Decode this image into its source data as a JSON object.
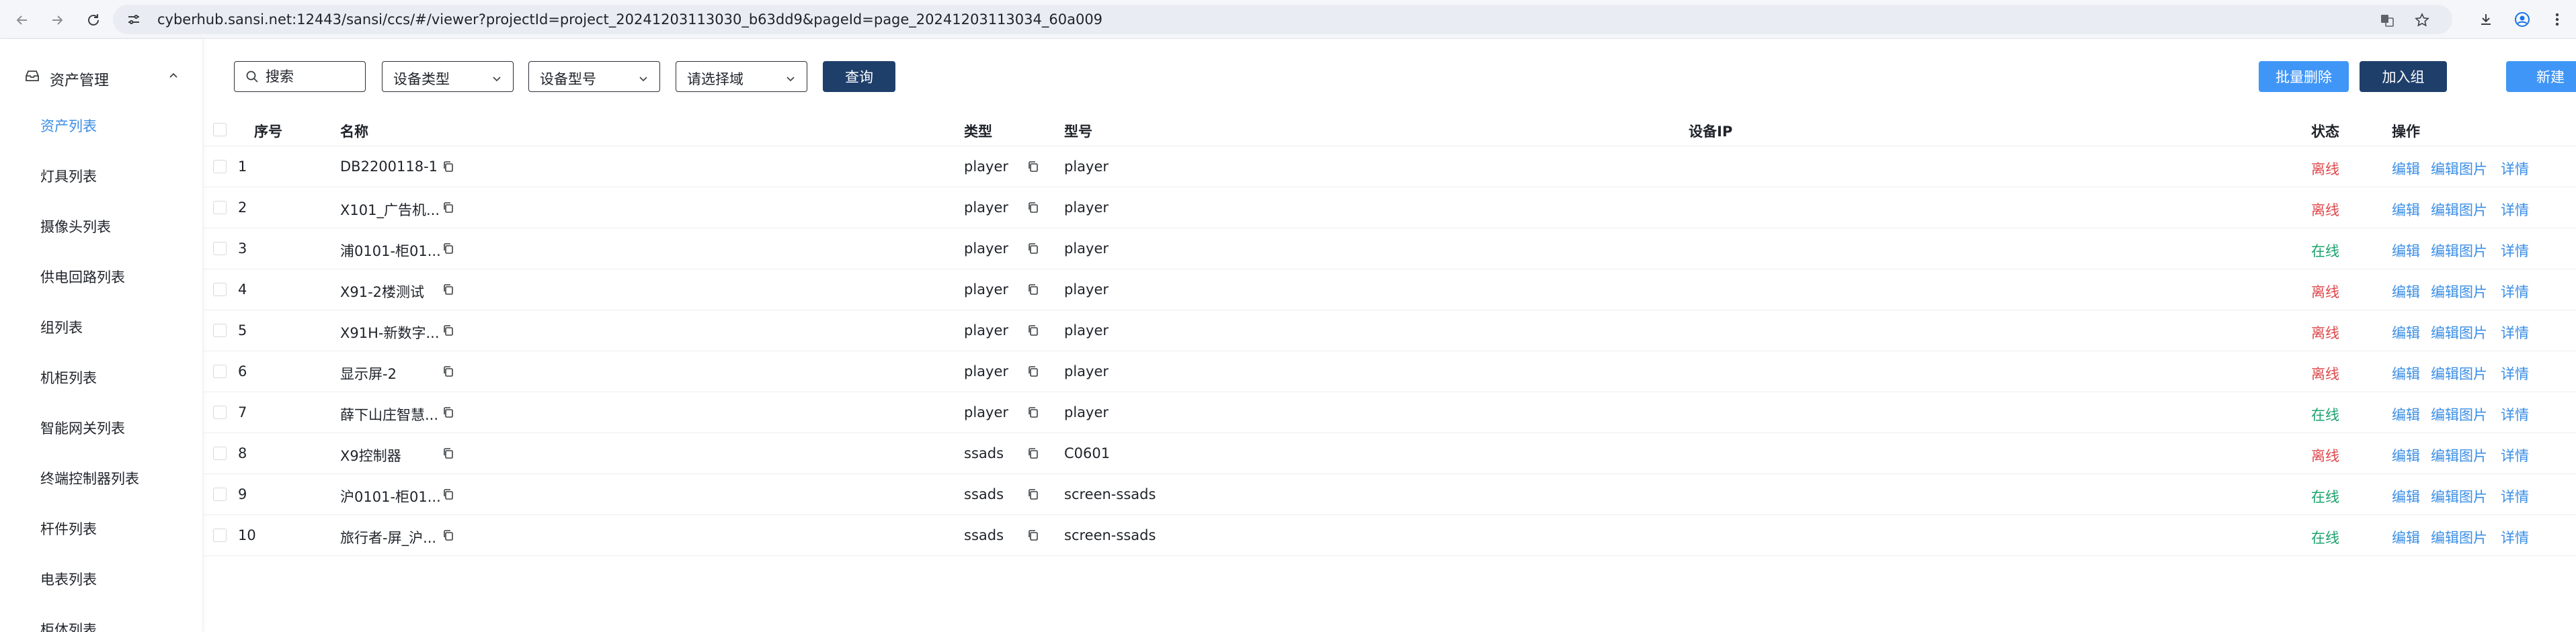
{
  "browser": {
    "url": "cyberhub.sansi.net:12443/sansi/ccs/#/viewer?projectId=project_20241203113030_b63dd9&pageId=page_20241203113034_60a009"
  },
  "sidebar": {
    "group_label": "资产管理",
    "items": [
      "资产列表",
      "灯具列表",
      "摄像头列表",
      "供电回路列表",
      "组列表",
      "机柜列表",
      "智能网关列表",
      "终端控制器列表",
      "杆件列表",
      "电表列表",
      "柜体列表"
    ],
    "active_index": 0
  },
  "toolbar": {
    "search_placeholder": "搜索",
    "device_type_placeholder": "设备类型",
    "device_model_placeholder": "设备型号",
    "area_placeholder": "请选择域",
    "query_label": "查询",
    "batch_delete_label": "批量删除",
    "join_group_label": "加入组",
    "new_label": "新建"
  },
  "table": {
    "headers": {
      "index": "序号",
      "name": "名称",
      "type": "类型",
      "model": "型号",
      "ip": "设备IP",
      "status": "状态",
      "actions": "操作"
    },
    "actions": {
      "edit": "编辑",
      "edit_image": "编辑图片",
      "detail": "详情"
    },
    "rows": [
      {
        "index": "1",
        "name": "DB2200118-1",
        "type": "player",
        "model": "player",
        "ip": "",
        "status": "离线",
        "online": false
      },
      {
        "index": "2",
        "name": "X101_广告机...",
        "type": "player",
        "model": "player",
        "ip": "",
        "status": "离线",
        "online": false
      },
      {
        "index": "3",
        "name": "浦0101-柜01...",
        "type": "player",
        "model": "player",
        "ip": "",
        "status": "在线",
        "online": true
      },
      {
        "index": "4",
        "name": "X91-2楼测试",
        "type": "player",
        "model": "player",
        "ip": "",
        "status": "离线",
        "online": false
      },
      {
        "index": "5",
        "name": "X91H-新数字...",
        "type": "player",
        "model": "player",
        "ip": "",
        "status": "离线",
        "online": false
      },
      {
        "index": "6",
        "name": "显示屏-2",
        "type": "player",
        "model": "player",
        "ip": "",
        "status": "离线",
        "online": false
      },
      {
        "index": "7",
        "name": "薛下山庄智慧...",
        "type": "player",
        "model": "player",
        "ip": "",
        "status": "在线",
        "online": true
      },
      {
        "index": "8",
        "name": "X9控制器",
        "type": "ssads",
        "model": "C0601",
        "ip": "",
        "status": "离线",
        "online": false
      },
      {
        "index": "9",
        "name": "沪0101-柜01...",
        "type": "ssads",
        "model": "screen-ssads",
        "ip": "",
        "status": "在线",
        "online": true
      },
      {
        "index": "10",
        "name": "旅行者-屏_沪...",
        "type": "ssads",
        "model": "screen-ssads",
        "ip": "",
        "status": "在线",
        "online": true
      }
    ]
  },
  "colors": {
    "accent": "#3a8ee6",
    "primary_dark": "#1f3f6b",
    "primary_blue": "#4096f7",
    "status_offline": "#e0474b",
    "status_online": "#1aa36b"
  }
}
